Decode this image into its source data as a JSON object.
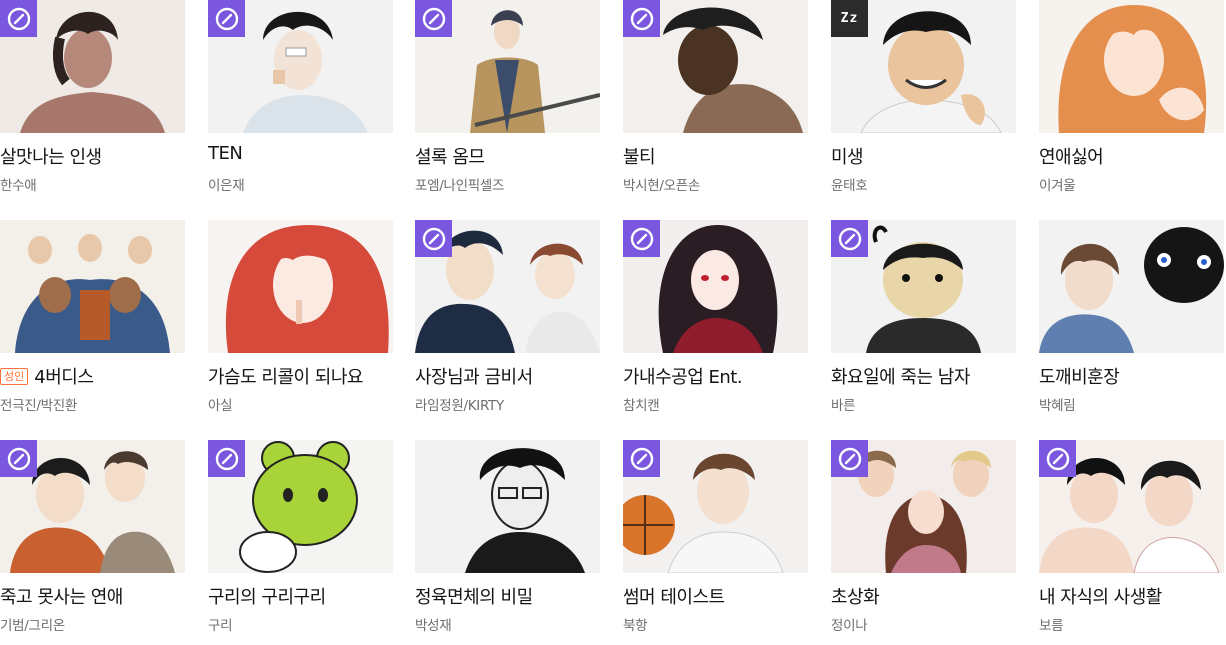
{
  "accent_colors": {
    "up_badge": "#7b57e0",
    "adult_badge": "#ff6f3c",
    "sleep_badge": "#2b2b2b"
  },
  "webtoons": [
    {
      "title": "살맛나는 인생",
      "author": "한수애",
      "badge": "up-icon",
      "adult": false
    },
    {
      "title": "TEN",
      "author": "이은재",
      "badge": "up-icon",
      "adult": false
    },
    {
      "title": "셜록 옴므",
      "author": "포엠/나인픽셀즈",
      "badge": "up-icon",
      "adult": false
    },
    {
      "title": "불티",
      "author": "박시현/오픈손",
      "badge": "up-icon",
      "adult": false
    },
    {
      "title": "미생",
      "author": "윤태호",
      "badge": "sleep-icon",
      "badge_text": "Zz",
      "adult": false
    },
    {
      "title": "연애싫어",
      "author": "이겨울",
      "badge": "",
      "adult": false
    },
    {
      "title": "4버디스",
      "author": "전극진/박진환",
      "badge": "",
      "adult": true,
      "adult_label": "성인"
    },
    {
      "title": "가슴도 리콜이 되나요",
      "author": "아실",
      "badge": "",
      "adult": false
    },
    {
      "title": "사장님과 금비서",
      "author": "라임정원/KIRTY",
      "badge": "up-icon",
      "adult": false
    },
    {
      "title": "가내수공업 Ent.",
      "author": "참치캔",
      "badge": "up-icon",
      "adult": false
    },
    {
      "title": "화요일에 죽는 남자",
      "author": "바른",
      "badge": "up-icon",
      "adult": false
    },
    {
      "title": "도깨비훈장",
      "author": "박혜림",
      "badge": "",
      "adult": false
    },
    {
      "title": "죽고 못사는 연애",
      "author": "기범/그리온",
      "badge": "up-icon",
      "adult": false
    },
    {
      "title": "구리의 구리구리",
      "author": "구리",
      "badge": "up-icon",
      "adult": false
    },
    {
      "title": "정육면체의 비밀",
      "author": "박성재",
      "badge": "",
      "adult": false
    },
    {
      "title": "썸머 테이스트",
      "author": "북항",
      "badge": "up-icon",
      "adult": false
    },
    {
      "title": "초상화",
      "author": "정이나",
      "badge": "up-icon",
      "adult": false
    },
    {
      "title": "내 자식의 사생활",
      "author": "보름",
      "badge": "up-icon",
      "adult": false
    }
  ]
}
